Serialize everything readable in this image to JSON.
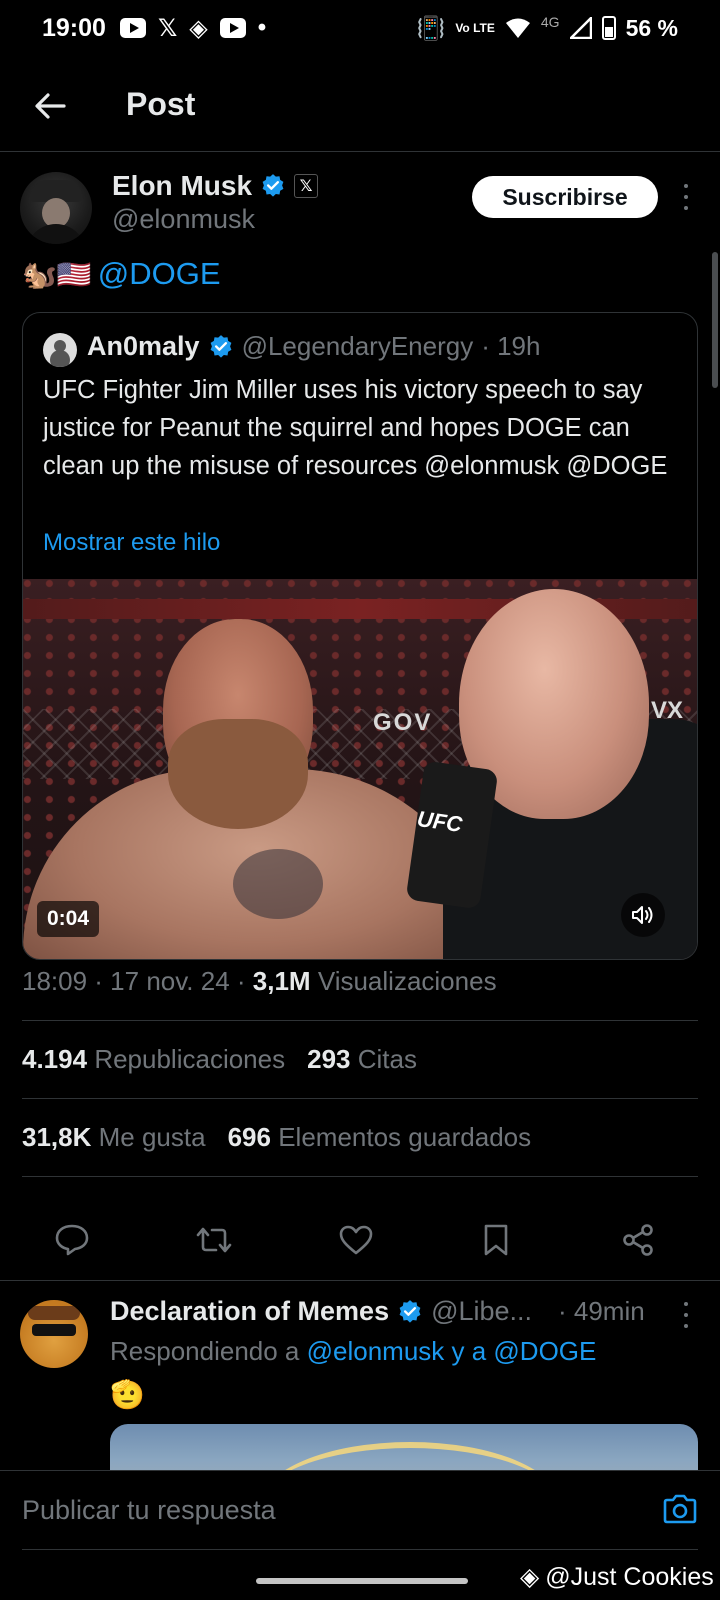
{
  "status_bar": {
    "time": "19:00",
    "battery": "56 %",
    "network": "4G",
    "volte": "Vo LTE",
    "left_icons": [
      "youtube-icon",
      "x-icon",
      "binance-icon",
      "youtube-icon"
    ],
    "right_icons": [
      "vibrate-icon",
      "volte-icon",
      "wifi-icon",
      "signal-icon",
      "battery-icon"
    ]
  },
  "header": {
    "title": "Post",
    "back_icon": "arrow-left-icon"
  },
  "post": {
    "author_name": "Elon Musk",
    "author_handle": "@elonmusk",
    "affiliation_badge": "𝕏",
    "subscribe_label": "Suscribirse",
    "text_emojis": "🐿️🇺🇸",
    "text_mention": "@DOGE",
    "quote": {
      "name": "An0maly",
      "handle": "@LegendaryEnergy",
      "time": "· 19h",
      "body": "UFC Fighter Jim Miller uses his victory speech to say justice for Peanut the squirrel and hopes DOGE can clean up the misuse of resources @elonmusk @DOGE",
      "show_thread": "Mostrar este hilo",
      "video_duration": "0:04",
      "video_mic_label": "UFC",
      "video_sign_left": "GOV",
      "video_sign_right": "VX"
    },
    "timestamp": "18:09 · 17 nov. 24 · ",
    "views_count": "3,1M",
    "views_label": "Visualizaciones",
    "reposts_count": "4.194",
    "reposts_label": "Republicaciones",
    "quotes_count": "293",
    "quotes_label": "Citas",
    "likes_count": "31,8K",
    "likes_label": "Me gusta",
    "bookmarks_count": "696",
    "bookmarks_label": "Elementos guardados",
    "actions": [
      "reply-icon",
      "repost-icon",
      "like-icon",
      "bookmark-icon",
      "share-icon"
    ]
  },
  "reply": {
    "name": "Declaration of Memes",
    "handle": "@Libe...",
    "time": "· 49min",
    "replying_prefix": "Respondiendo a ",
    "replying_mentions": "@elonmusk y a @DOGE",
    "emoji": "🫡"
  },
  "composer": {
    "placeholder": "Publicar tu respuesta"
  },
  "navbar": {
    "watermark": "@Just Cookies"
  },
  "colors": {
    "accent": "#1d9bf0",
    "background": "#000000",
    "muted": "#71767b",
    "divider": "#2f3336"
  }
}
